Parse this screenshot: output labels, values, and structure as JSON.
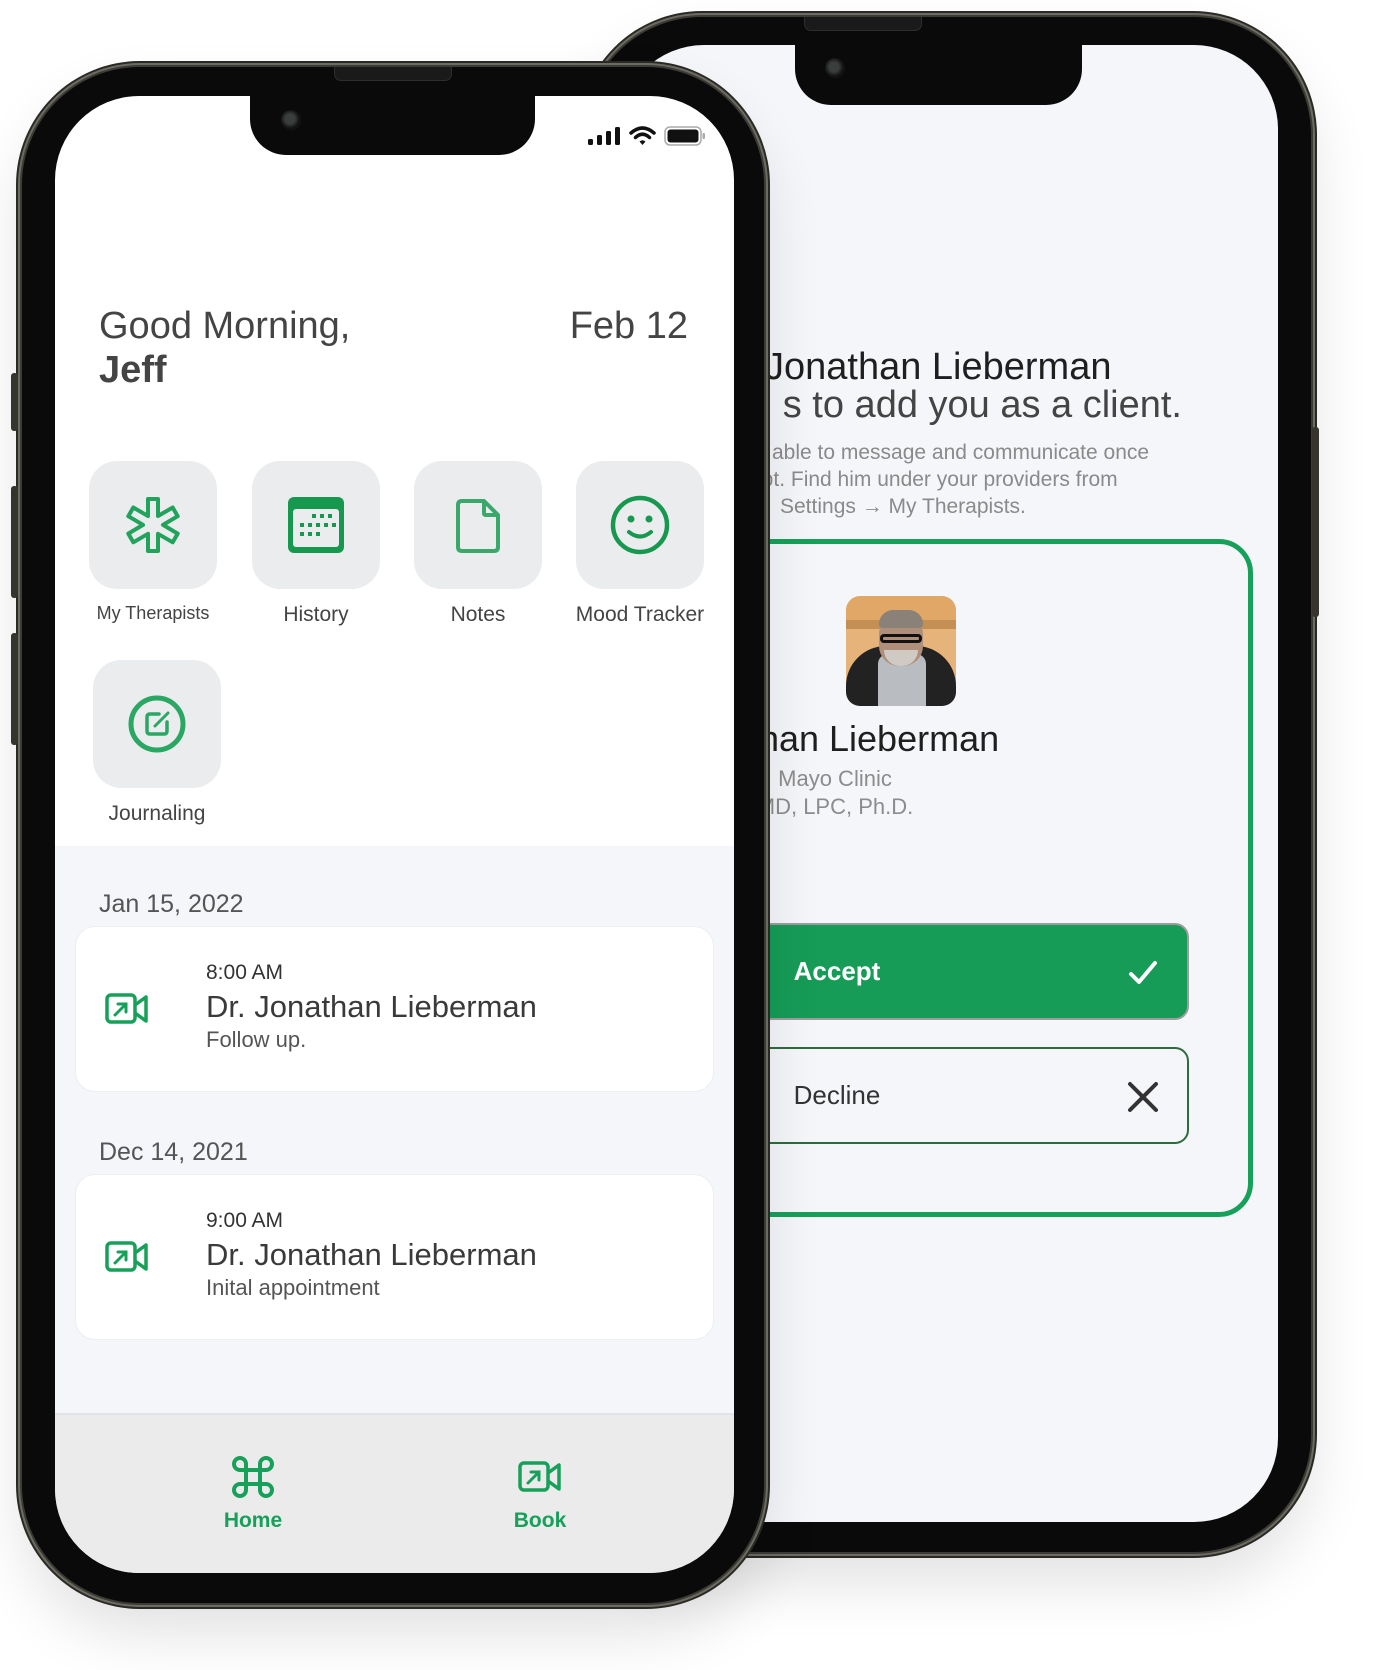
{
  "colors": {
    "accent": "#17a05a",
    "tile_bg": "#ebecee",
    "list_bg": "#f5f6fa",
    "tabbar_bg": "#ebebeb"
  },
  "invite_screen": {
    "heading_line1": "Jonathan Lieberman",
    "heading_line2": "s to add you as a client.",
    "description": [
      "able to message and communicate once",
      "ept. Find him under your providers from",
      "Settings → My Therapists."
    ],
    "therapist": {
      "name": "Jonathan Lieberman",
      "organization": "Mayo Clinic",
      "credentials": "MD, LPC, Ph.D.",
      "photo_icon": "therapist-photo"
    },
    "accept_label": "Accept",
    "accept_icon": "checkmark-icon",
    "decline_label": "Decline",
    "decline_icon": "close-icon"
  },
  "home_screen": {
    "status_bar": {
      "icons": [
        "signal-icon",
        "wifi-icon",
        "battery-icon"
      ]
    },
    "greeting": "Good Morning,",
    "user_name": "Jeff",
    "date": "Feb 12",
    "tiles": [
      {
        "label": "My Therapists",
        "icon": "asterisk-icon"
      },
      {
        "label": "History",
        "icon": "calendar-icon"
      },
      {
        "label": "Notes",
        "icon": "document-icon"
      },
      {
        "label": "Mood Tracker",
        "icon": "smiley-icon"
      },
      {
        "label": "Journaling",
        "icon": "edit-icon"
      }
    ],
    "appointments": [
      {
        "date": "Jan 15, 2022",
        "time": "8:00 AM",
        "doctor": "Dr. Jonathan Lieberman",
        "note": "Follow up.",
        "icon": "video-call-icon"
      },
      {
        "date": "Dec 14, 2021",
        "time": "9:00 AM",
        "doctor": "Dr. Jonathan Lieberman",
        "note": "Inital appointment",
        "icon": "video-call-icon"
      }
    ],
    "tabbar": [
      {
        "label": "Home",
        "icon": "command-icon"
      },
      {
        "label": "Book",
        "icon": "video-call-icon"
      }
    ]
  }
}
